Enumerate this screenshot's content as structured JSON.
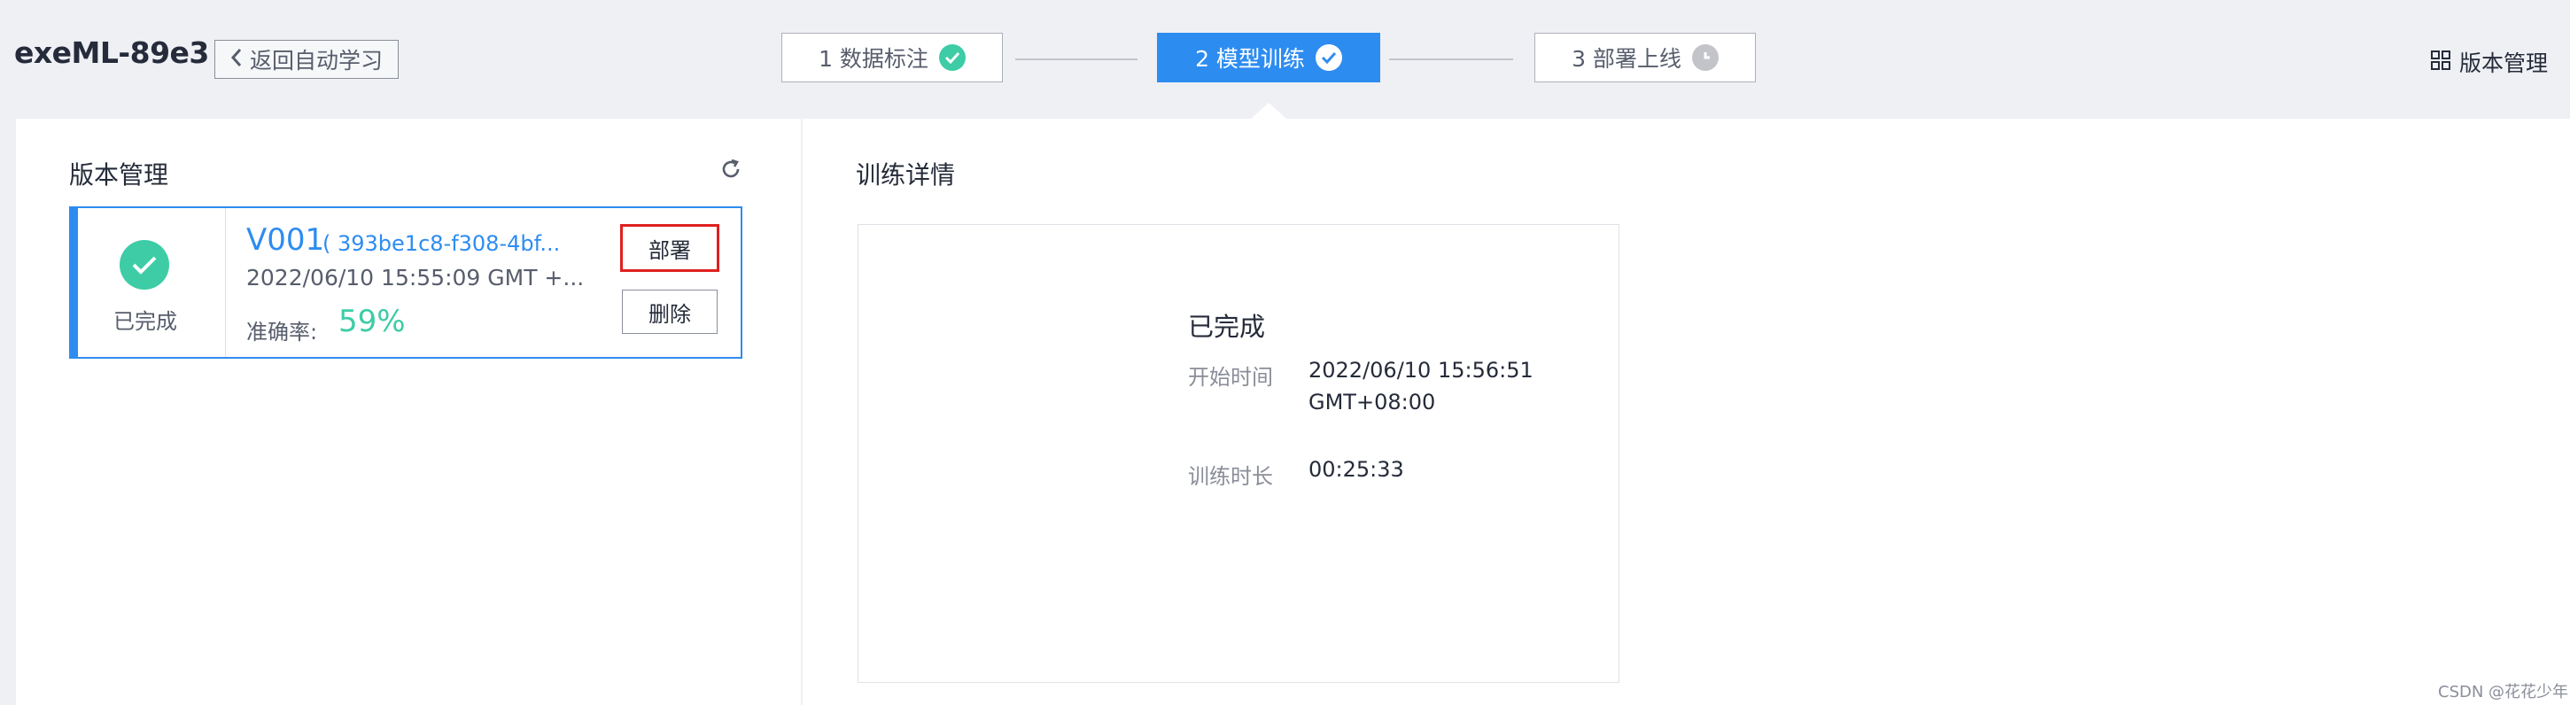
{
  "app": {
    "title": "exeML-89e3",
    "back_label": "返回自动学习"
  },
  "steps": [
    {
      "label": "1 数据标注",
      "status": "done",
      "icon": "check-circle-icon"
    },
    {
      "label": "2 模型训练",
      "status": "active",
      "icon": "check-circle-icon"
    },
    {
      "label": "3 部署上线",
      "status": "pending",
      "icon": "clock-icon"
    }
  ],
  "header": {
    "version_mgmt_label": "版本管理",
    "version_mgmt_icon": "grid-icon"
  },
  "left_panel": {
    "title": "版本管理",
    "refresh_icon": "refresh-icon",
    "version_card": {
      "status": "已完成",
      "status_icon": "check-circle-icon",
      "name": "V001",
      "id": "( 393be1c8-f308-4bf...",
      "time": "2022/06/10 15:55:09 GMT +...",
      "accuracy_label": "准确率:",
      "accuracy_value": "59%",
      "deploy_label": "部署",
      "delete_label": "删除"
    }
  },
  "right_panel": {
    "title": "训练详情",
    "detail": {
      "status": "已完成",
      "start_label": "开始时间",
      "start_value_line1": "2022/06/10 15:56:51",
      "start_value_line2": "GMT+08:00",
      "duration_label": "训练时长",
      "duration_value": "00:25:33"
    }
  },
  "watermark": "CSDN @花花少年",
  "colors": {
    "accent": "#2d8cf0",
    "success": "#3dcca6",
    "highlight": "#e02020",
    "background": "#eff0f4"
  }
}
